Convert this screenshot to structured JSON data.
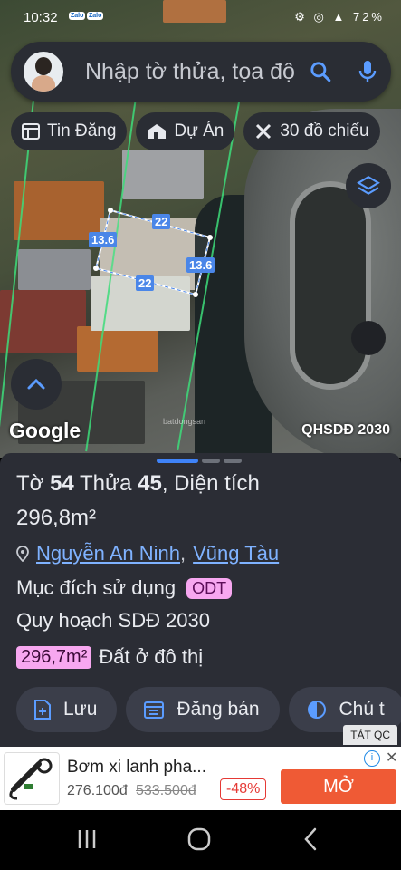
{
  "status_bar": {
    "time": "10:32",
    "zalo_label": "Zalo",
    "signal_text": "72%"
  },
  "search": {
    "placeholder": "Nhập tờ thửa, tọa độ",
    "search_icon": "search-icon",
    "mic_icon": "mic-icon"
  },
  "chips": [
    {
      "label": "Tin Đăng",
      "icon": "list-icon"
    },
    {
      "label": "Dự Án",
      "icon": "house-icon"
    },
    {
      "label": "30 đồ chiếu",
      "icon": "cross-tools-icon"
    }
  ],
  "map": {
    "measurements": {
      "top": "22",
      "left": "13.6",
      "right": "13.6",
      "bottom": "22"
    },
    "watermark": "batdongsan",
    "provider": "Google",
    "layer_label": "QHSDĐ 2030"
  },
  "sheet": {
    "title": {
      "prefix": "Tờ",
      "sheet_no": "54",
      "mid": "Thửa",
      "parcel_no": "45",
      "suffix": ", Diện tích"
    },
    "area": "296,8m²",
    "address": {
      "street": "Nguyễn An Ninh",
      "sep": ",",
      "city": "Vũng Tàu"
    },
    "purpose_label": "Mục đích sử dụng",
    "purpose_code": "ODT",
    "plan_label": "Quy hoạch SDĐ 2030",
    "plan_area": "296,7m²",
    "plan_use": "Đất ở đô thị",
    "actions": [
      {
        "label": "Lưu",
        "icon": "save-icon"
      },
      {
        "label": "Đăng bán",
        "icon": "calendar-icon"
      },
      {
        "label": "Chú t",
        "icon": "contrast-icon"
      }
    ]
  },
  "ad": {
    "hide_label": "TẮT QC",
    "product_name": "Bơm xi lanh pha...",
    "price": "276.100đ",
    "old_price": "533.500đ",
    "discount": "-48%",
    "cta": "MỞ"
  },
  "colors": {
    "accent": "#3f83f8",
    "pink": "#f7a7f0",
    "cta": "#ef5a35"
  }
}
